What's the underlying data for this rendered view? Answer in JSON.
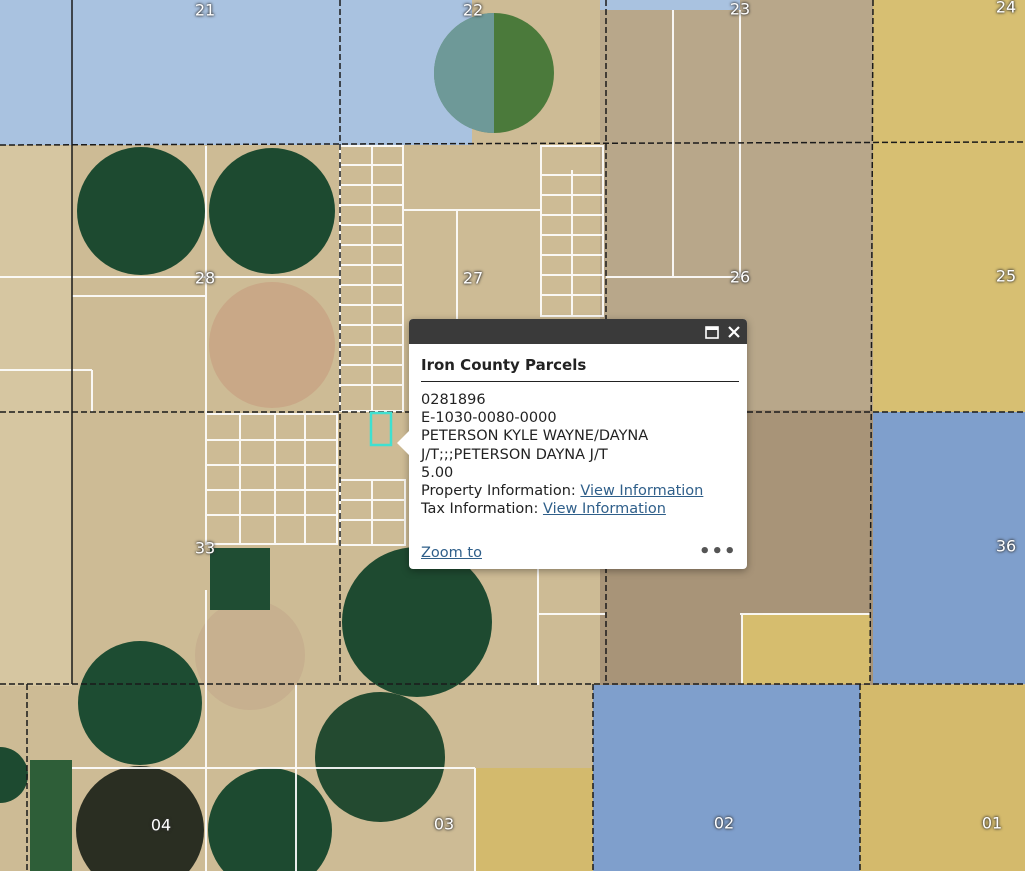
{
  "map": {
    "section_labels": [
      "21",
      "22",
      "23",
      "24",
      "28",
      "27",
      "26",
      "25",
      "33",
      "36",
      "04",
      "03",
      "02",
      "01"
    ],
    "colors": {
      "desert": "#c9b892",
      "farmland_green": "#1f4a32",
      "blue_overlay": "#8eaed8",
      "yellow_overlay": "#d8c06a",
      "parcel_line": "#ffffff",
      "section_line": "#1a1a1a",
      "selected_parcel": "#40e0d0"
    }
  },
  "popup": {
    "title": "Iron County Parcels",
    "parcel_number": "0281896",
    "account": "E-1030-0080-0000",
    "owner_line1": "PETERSON KYLE WAYNE/DAYNA",
    "owner_line2": "J/T;;;PETERSON DAYNA J/T",
    "acres": "5.00",
    "property_label": "Property Information:",
    "property_link": "View Information",
    "tax_label": "Tax Information:",
    "tax_link": "View Information",
    "zoom_label": "Zoom to",
    "header_bg": "#3a3a3a",
    "link_color": "#2f5f8a"
  }
}
